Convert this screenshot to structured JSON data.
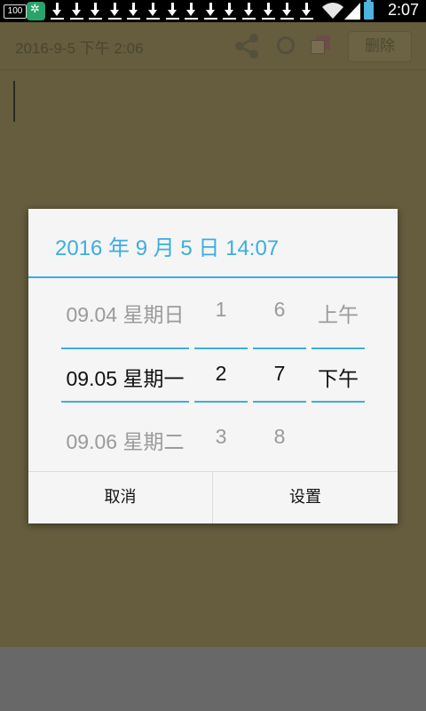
{
  "status_bar": {
    "battery_left": "100",
    "time": "2:07",
    "download_count": 14
  },
  "note": {
    "date_label": "2016-9-5 下午 2:06",
    "delete_label": "删除"
  },
  "dialog": {
    "title": "2016 年 9 月 5 日 14:07",
    "date_col": {
      "prev": "09.04 星期日",
      "current": "09.05 星期一",
      "next": "09.06 星期二"
    },
    "hour_col": {
      "prev": "1",
      "current": "2",
      "next": "3"
    },
    "minute_col": {
      "prev": "6",
      "current": "7",
      "next": "8"
    },
    "ampm_col": {
      "prev": "上午",
      "current": "下午",
      "next": ""
    },
    "cancel_label": "取消",
    "set_label": "设置"
  },
  "colors": {
    "accent": "#3aaee0",
    "note_bg_dimmed": "#655d3e",
    "dialog_bg": "#f5f5f5"
  }
}
